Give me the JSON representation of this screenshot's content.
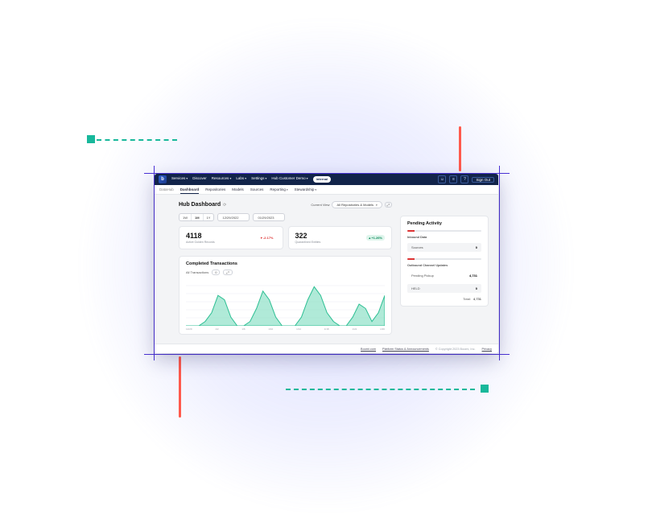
{
  "colors": {
    "accent": "#12244a",
    "teal": "#18b89b",
    "red": "#ff5a4d",
    "indigo": "#4a32d6"
  },
  "topbar": {
    "logo_letter": "b",
    "nav": [
      "Services",
      "Discover",
      "Resources",
      "Labs",
      "Settings",
      "Hub Customer Demo"
    ],
    "env_badge": "internal",
    "icons": [
      "user",
      "activity",
      "help"
    ],
    "signout": "Sign Out"
  },
  "tabs": {
    "section": "DataHub",
    "items": [
      "Dashboard",
      "Repositories",
      "Models",
      "Sources",
      "Reporting",
      "Stewardship"
    ],
    "active": "Dashboard",
    "dropdown_tabs": [
      "Reporting",
      "Stewardship"
    ]
  },
  "page": {
    "title": "Hub Dashboard",
    "title_icon": "refresh",
    "current_view_label": "Current View",
    "current_view_value": "All Repositories & Models",
    "view_filter_icon": "expand"
  },
  "filters": {
    "segments": [
      "1W",
      "1M",
      "1Y"
    ],
    "segment_active": "1M",
    "date_from": "12/29/2022",
    "date_to": "01/29/2023"
  },
  "kpis": [
    {
      "value": "4118",
      "label": "Active Golden Records",
      "delta": "-2.17%",
      "direction": "down"
    },
    {
      "value": "322",
      "label": "Quarantined Entities",
      "delta": "+1.26%",
      "direction": "up"
    }
  ],
  "chart": {
    "title": "Completed Transactions",
    "series_label": "All Transactions",
    "series_count": "0",
    "expand_icon": "expand"
  },
  "chart_data": {
    "type": "area",
    "title": "Completed Transactions",
    "xlabel": "",
    "ylabel": "",
    "ylim": [
      0,
      10
    ],
    "categories": [
      "12/29",
      "12/30",
      "12/31",
      "1/1",
      "1/2",
      "1/3",
      "1/4",
      "1/5",
      "1/6",
      "1/7",
      "1/8",
      "1/9",
      "1/10",
      "1/11",
      "1/12",
      "1/13",
      "1/14",
      "1/15",
      "1/16",
      "1/17",
      "1/18",
      "1/19",
      "1/20",
      "1/21",
      "1/22",
      "1/23",
      "1/24",
      "1/25",
      "1/26",
      "1/27",
      "1/28",
      "1/29"
    ],
    "series": [
      {
        "name": "All Transactions",
        "values": [
          0,
          0,
          0,
          1,
          3,
          7,
          6,
          2,
          0,
          0,
          1,
          4,
          8,
          6,
          2,
          0,
          0,
          0,
          2,
          6,
          9,
          7,
          3,
          1,
          0,
          0,
          2,
          5,
          4,
          1,
          3,
          7
        ]
      }
    ]
  },
  "pending": {
    "title": "Pending Activity",
    "groups": [
      {
        "name": "Inbound Data",
        "rows": [
          {
            "label": "Sources",
            "value": "0"
          }
        ]
      },
      {
        "name": "Outbound Channel Updates",
        "rows": [
          {
            "label": "Pending Pickup",
            "value": "4,731"
          },
          {
            "label": "HELD",
            "value": "0"
          }
        ],
        "total_label": "Total:",
        "total_value": "4,731"
      }
    ]
  },
  "footer": {
    "links": [
      "Boomi.com",
      "Platform Status & Announcements"
    ],
    "copyright": "© Copyright 2023 Boomi, Inc.",
    "privacy": "Privacy"
  }
}
